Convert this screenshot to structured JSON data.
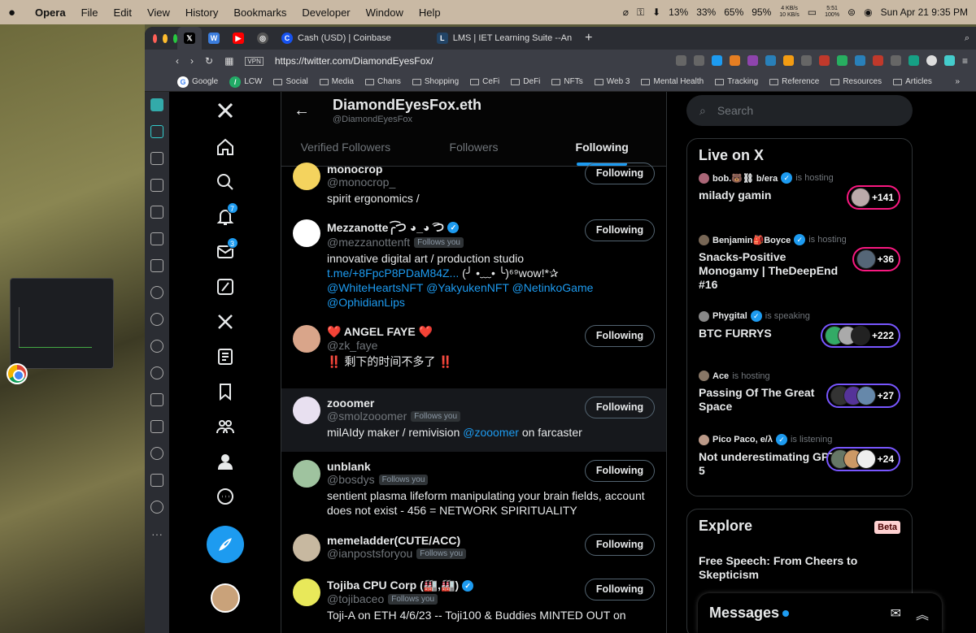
{
  "menubar": {
    "app": "Opera",
    "items": [
      "File",
      "Edit",
      "View",
      "History",
      "Bookmarks",
      "Developer",
      "Window",
      "Help"
    ],
    "cpu": [
      "13%",
      "33%",
      "65%",
      "95%"
    ],
    "net_up": "4 KB/s",
    "net_down": "10 KB/s",
    "time_top": "5:51",
    "battery": "100%",
    "datetime": "Sun Apr 21  9:35 PM"
  },
  "tabs": [
    {
      "label": "Cash (USD) | Coinbase"
    },
    {
      "label": "LMS | IET Learning Suite --An"
    }
  ],
  "address": {
    "url": "https://twitter.com/DiamondEyesFox/"
  },
  "bookmarks": [
    "Google",
    "LCW",
    "Social",
    "Media",
    "Chans",
    "Shopping",
    "CeFi",
    "DeFi",
    "NFTs",
    "Web 3",
    "Mental Health",
    "Tracking",
    "Reference",
    "Resources",
    "Articles"
  ],
  "nav": {
    "notif_badge": "7",
    "msg_badge": "3"
  },
  "profile": {
    "name": "DiamondEyesFox.eth",
    "handle": "@DiamondEyesFox",
    "tabs": [
      "Verified Followers",
      "Followers",
      "Following"
    ]
  },
  "users": [
    {
      "name": "monocrop",
      "handle": "@monocrop_",
      "follows_you": "",
      "bio": "spirit ergonomics /",
      "btn": "Following"
    },
    {
      "name": "Mezzanotte╭͡つ ◕_◕ ͡つ",
      "handle": "@mezzanottenft",
      "follows_you": "Follows you",
      "bio": "innovative digital art / production studio",
      "link1": "t.me/+8FpcP8PDaM84Z...",
      "bio2": " (╯ •﹏• ╰)⁶⁹wow!*✰",
      "link2": "@WhiteHeartsNFT @YakyukenNFT @NetinkoGame",
      "link3": "@OphidianLips",
      "btn": "Following"
    },
    {
      "name": "❤️ ANGEL FAYE ❤️",
      "handle": "@zk_faye",
      "follows_you": "",
      "bio": "‼️ 剩下的时间不多了 ‼️",
      "btn": "Following"
    },
    {
      "name": "zooomer",
      "handle": "@smolzooomer",
      "follows_you": "Follows you",
      "bio": "milAIdy maker / remivision ",
      "link1": "@zooomer",
      "bio2": " on farcaster",
      "btn": "Following"
    },
    {
      "name": "unblank",
      "handle": "@bosdys",
      "follows_you": "Follows you",
      "bio": "sentient plasma lifeform manipulating your brain fields, account does not exist - 456 = NETWORK SPIRITUALITY",
      "btn": "Following"
    },
    {
      "name": "memeladder(CUTE/ACC)",
      "handle": "@ianpostsforyou",
      "follows_you": "Follows you",
      "bio": "",
      "btn": "Following"
    },
    {
      "name": "Tojiba CPU Corp (🏭,🏭)",
      "handle": "@tojibaceo",
      "follows_you": "Follows you",
      "bio": "Toji-A on ETH 4/6/23 -- Toji100 & Buddies MINTED OUT on",
      "btn": "Following"
    }
  ],
  "search": {
    "placeholder": "Search"
  },
  "live": {
    "title": "Live on X",
    "items": [
      {
        "host": "bob.🐻⛓ b/era",
        "status": "is hosting",
        "title": "milady gamin",
        "count": "+141"
      },
      {
        "host": "Benjamin🎒Boyce",
        "status": "is hosting",
        "title": "Snacks-Positive Monogamy | TheDeepEnd #16",
        "count": "+36"
      },
      {
        "host": "Phygital",
        "status": "is speaking",
        "title": "BTC FURRYS",
        "count": "+222"
      },
      {
        "host": "Ace",
        "status": "is hosting",
        "title": "Passing Of The Great Space",
        "count": "+27"
      },
      {
        "host": "Pico Paco, e/λ",
        "status": "is listening",
        "title": "Not underestimating GPT-5",
        "count": "+24"
      }
    ]
  },
  "explore": {
    "title": "Explore",
    "beta": "Beta",
    "item": "Free Speech: From Cheers to Skepticism"
  },
  "messages": {
    "label": "Messages"
  }
}
